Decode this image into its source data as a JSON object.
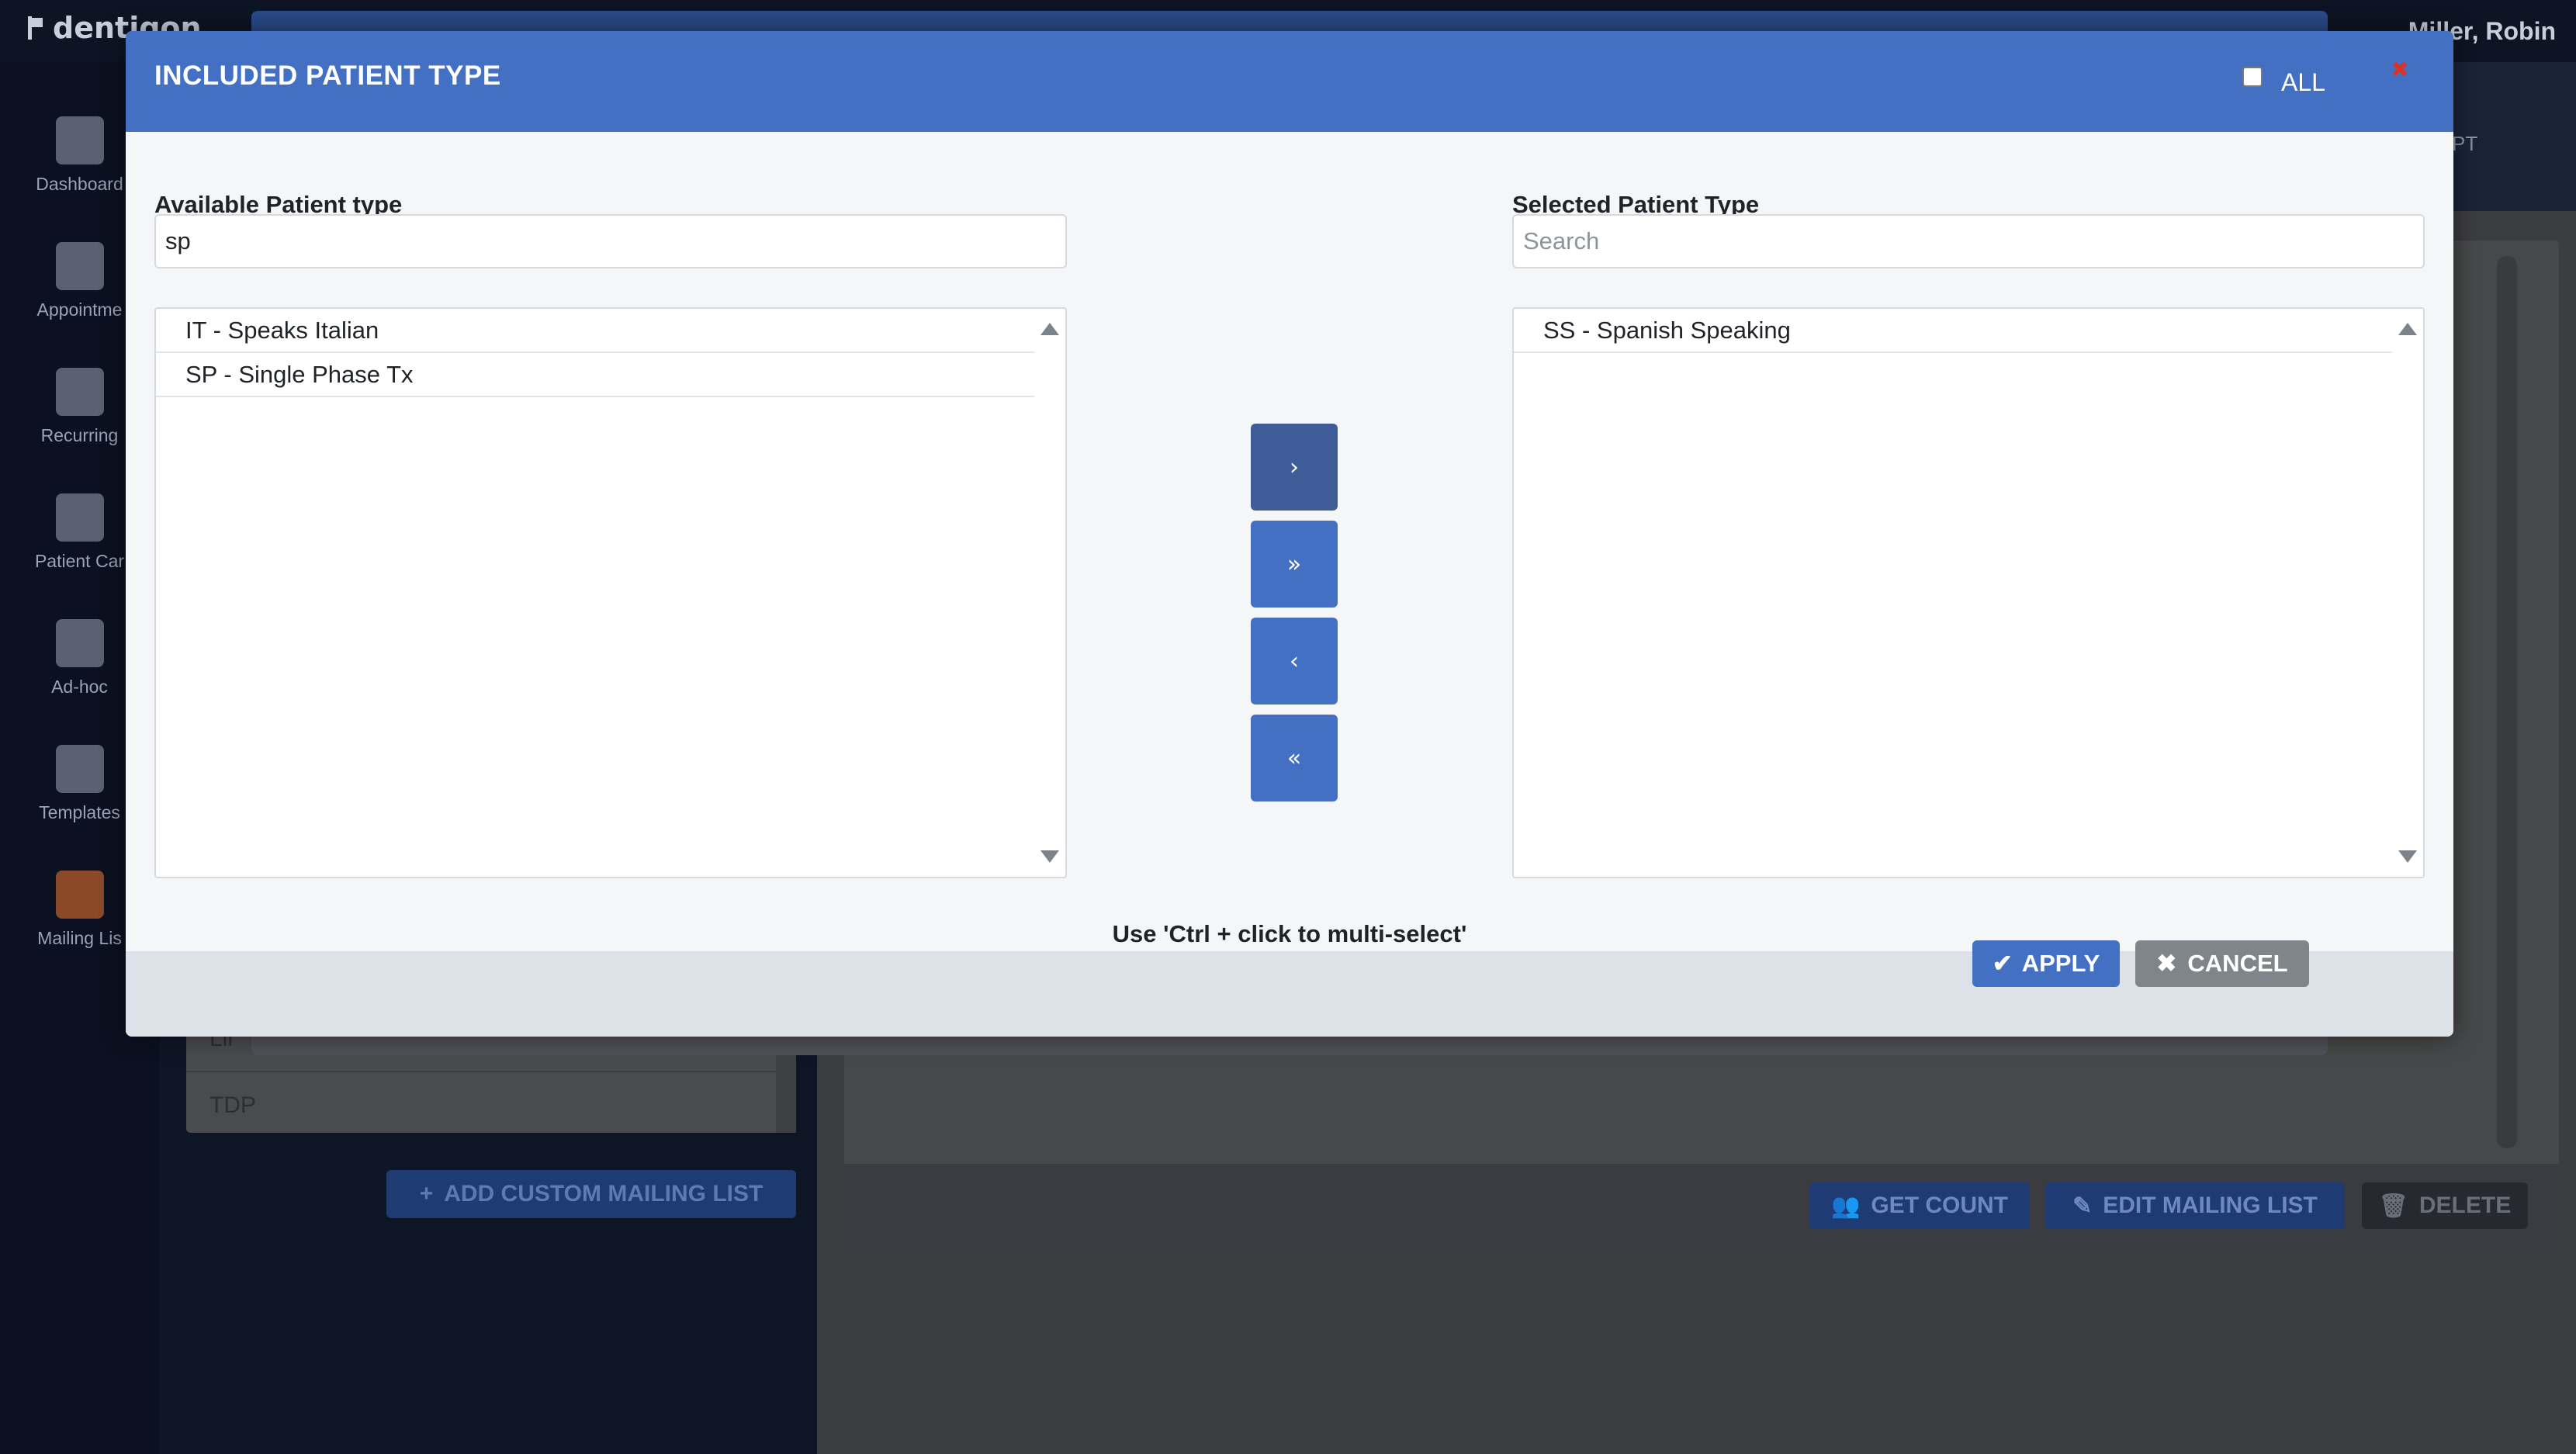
{
  "app": {
    "logo_text": "dentiqon",
    "user_name": "Miller, Robin",
    "header_tag": "PT"
  },
  "sidebar": {
    "items": [
      {
        "label": "Dashboard",
        "icon": "dashboard-icon"
      },
      {
        "label": "Appointme",
        "icon": "appointments-icon"
      },
      {
        "label": "Recurring",
        "icon": "recurring-icon"
      },
      {
        "label": "Patient Car",
        "icon": "patient-care-icon"
      },
      {
        "label": "Ad-hoc",
        "icon": "ad-hoc-icon"
      },
      {
        "label": "Templates",
        "icon": "templates-icon"
      },
      {
        "label": "Mailing Lis",
        "icon": "mailing-list-icon"
      }
    ]
  },
  "background": {
    "list_rows": [
      "Lir",
      "TDP"
    ],
    "add_list_label": "ADD CUSTOM MAILING LIST",
    "get_count_label": "GET COUNT",
    "edit_list_label": "EDIT MAILING LIST",
    "delete_label": "DELETE"
  },
  "modal": {
    "title": "INCLUDED PATIENT TYPE",
    "all_label": "ALL",
    "all_checked": false,
    "close_glyph": "✖",
    "available": {
      "label": "Available Patient type",
      "search_value": "sp",
      "options": [
        "IT - Speaks Italian",
        "SP - Single Phase Tx"
      ]
    },
    "selected": {
      "label": "Selected Patient Type",
      "search_placeholder": "Search",
      "options": [
        "SS - Spanish Speaking"
      ]
    },
    "buttons": {
      "move_right": "›",
      "move_all_right": "»",
      "move_left": "‹",
      "move_all_left": "«"
    },
    "hint": "Use 'Ctrl + click to multi-select'",
    "apply_label": "APPLY",
    "cancel_label": "CANCEL"
  },
  "colors": {
    "header_blue": "#4470c4",
    "cancel_grey": "#7f858b",
    "close_red": "#d8332a"
  }
}
